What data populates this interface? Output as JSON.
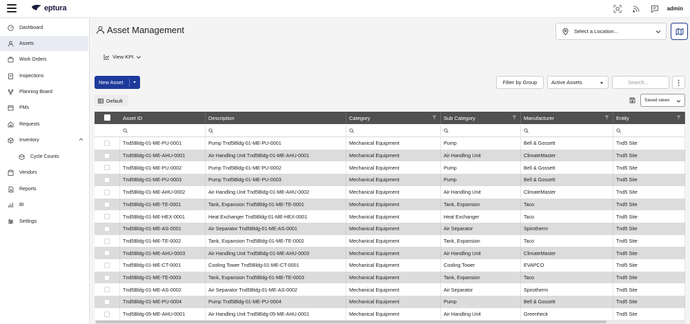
{
  "app": {
    "brand": "eptura",
    "user": "admin"
  },
  "topbar_icons": [
    "qr-scan-icon",
    "rss-feed-icon",
    "chat-icon"
  ],
  "sidebar": {
    "items": [
      {
        "label": "Dashboard",
        "icon": "dashboard-icon",
        "active": false
      },
      {
        "label": "Assets",
        "icon": "assets-icon",
        "active": true
      },
      {
        "label": "Work Orders",
        "icon": "work-orders-icon",
        "active": false
      },
      {
        "label": "Inspections",
        "icon": "inspections-icon",
        "active": false
      },
      {
        "label": "Planning Board",
        "icon": "planning-board-icon",
        "active": false
      },
      {
        "label": "PMs",
        "icon": "pms-icon",
        "active": false
      },
      {
        "label": "Requests",
        "icon": "requests-icon",
        "active": false
      },
      {
        "label": "Inventory",
        "icon": "inventory-icon",
        "active": false,
        "expanded": true
      },
      {
        "label": "Cycle Counts",
        "icon": "cycle-counts-icon",
        "active": false,
        "sub": true
      },
      {
        "label": "Vendors",
        "icon": "vendors-icon",
        "active": false
      },
      {
        "label": "Reports",
        "icon": "reports-icon",
        "active": false
      },
      {
        "label": "BI",
        "icon": "bi-icon",
        "active": false
      },
      {
        "label": "Settings",
        "icon": "settings-icon",
        "active": false
      }
    ]
  },
  "page": {
    "title": "Asset Management",
    "title_icon": "asset-person-icon"
  },
  "location": {
    "placeholder": "Select a Location...",
    "icon": "map-pin-icon"
  },
  "kpi": {
    "label": "View KPI"
  },
  "toolbar": {
    "new_asset": "New Asset",
    "filter_by_group": "Filter by Group",
    "active_filter": "Active Assets",
    "search_placeholder": "Search...",
    "default_view": "Default",
    "saved_views": "Saved views"
  },
  "grid": {
    "columns": [
      "Asset ID",
      "Description",
      "Category",
      "Sub Category",
      "Manufacturer",
      "Entity"
    ],
    "rows": [
      [
        "Tnd5Bldg-01-ME-PU-0001",
        "Pump Tnd5Bldg-01-ME-PU-0001",
        "Mechanical Equipment",
        "Pump",
        "Bell & Gossett",
        "Tnd5 Site"
      ],
      [
        "Tnd5Bldg-01-ME-AHU-0001",
        "Air Handling Unit Tnd5Bldg-01-ME-AHU-0001",
        "Mechanical Equipment",
        "Air Handling Unit",
        "ClimateMaster",
        "Tnd5 Site"
      ],
      [
        "Tnd5Bldg-01-ME-PU-0002",
        "Pump Tnd5Bldg-01-ME-PU-0002",
        "Mechanical Equipment",
        "Pump",
        "Bell & Gossett",
        "Tnd5 Site"
      ],
      [
        "Tnd5Bldg-01-ME-PU-0003",
        "Pump Tnd5Bldg-01-ME-PU-0003",
        "Mechanical Equipment",
        "Pump",
        "Bell & Gossett",
        "Tnd5 Site"
      ],
      [
        "Tnd5Bldg-01-ME-AHU-0002",
        "Air Handling Unit Tnd5Bldg-01-ME-AHU-0002",
        "Mechanical Equipment",
        "Air Handling Unit",
        "ClimateMaster",
        "Tnd5 Site"
      ],
      [
        "Tnd5Bldg-01-ME-TE-0001",
        "Tank, Expansion Tnd5Bldg-01-ME-TE-0001",
        "Mechanical Equipment",
        "Tank, Expansion",
        "Taco",
        "Tnd5 Site"
      ],
      [
        "Tnd5Bldg-01-ME-HEX-0001",
        "Heat Exchanger Tnd5Bldg-01-ME-HEX-0001",
        "Mechanical Equipment",
        "Heat Exchanger",
        "Taco",
        "Tnd5 Site"
      ],
      [
        "Tnd5Bldg-01-ME-AS-0001",
        "Air Separator Tnd5Bldg-01-ME-AS-0001",
        "Mechanical Equipment",
        "Air Separator",
        "Spirotherm",
        "Tnd5 Site"
      ],
      [
        "Tnd5Bldg-01-ME-TE-0002",
        "Tank, Expansion Tnd5Bldg-01-ME-TE-0002",
        "Mechanical Equipment",
        "Tank, Expansion",
        "Taco",
        "Tnd5 Site"
      ],
      [
        "Tnd5Bldg-01-ME-AHU-0003",
        "Air Handling Unit Tnd5Bldg-01-ME-AHU-0003",
        "Mechanical Equipment",
        "Air Handling Unit",
        "ClimateMaster",
        "Tnd5 Site"
      ],
      [
        "Tnd5Bldg-01-ME-CT-0001",
        "Cooling Tower Tnd5Bldg-01-ME-CT-0001",
        "Mechanical Equipment",
        "Cooling Tower",
        "EVAPCO",
        "Tnd5 Site"
      ],
      [
        "Tnd5Bldg-01-ME-TE-0003",
        "Tank, Expansion Tnd5Bldg-01-ME-TE-0003",
        "Mechanical Equipment",
        "Tank, Expansion",
        "Taco",
        "Tnd5 Site"
      ],
      [
        "Tnd5Bldg-01-ME-AS-0002",
        "Air Separator Tnd5Bldg-01-ME-AS-0002",
        "Mechanical Equipment",
        "Air Separator",
        "Spirotherm",
        "Tnd5 Site"
      ],
      [
        "Tnd5Bldg-01-ME-PU-0004",
        "Pump Tnd5Bldg-01-ME-PU-0004",
        "Mechanical Equipment",
        "Pump",
        "Bell & Gossett",
        "Tnd5 Site"
      ],
      [
        "Tnd5Bldg-05-ME-AHU-0001",
        "Air Handling Unit Tnd5Bldg-05-ME-AHU-0001",
        "Mechanical Equipment",
        "Air Handling Unit",
        "Greenheck",
        "Tnd5 Site"
      ]
    ]
  },
  "colors": {
    "primary": "#1e3a9a",
    "header": "#505050",
    "row_alt": "#dcdcdc",
    "active_nav": "#e8ebf3"
  }
}
